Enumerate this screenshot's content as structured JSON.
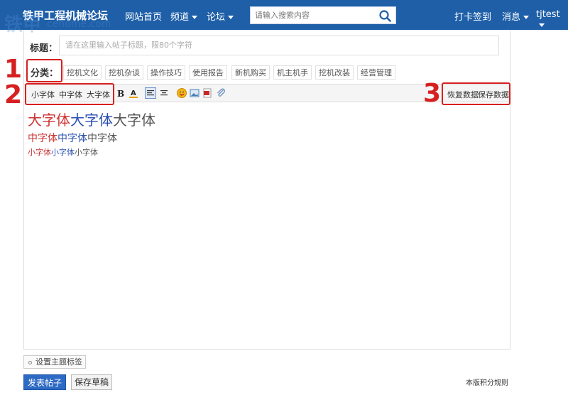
{
  "header": {
    "logo": "铁甲工程机械论坛",
    "watermark": "铁甲",
    "watermark_sub": "cehome.com",
    "nav": [
      {
        "label": "网站首页",
        "has_caret": false
      },
      {
        "label": "频道",
        "has_caret": true
      },
      {
        "label": "论坛",
        "has_caret": true
      }
    ],
    "search_placeholder": "请输入搜索内容",
    "checkin": "打卡签到",
    "messages": "消息",
    "username": "tjtest"
  },
  "form": {
    "title_label": "标题：",
    "title_placeholder": "请在这里输入帖子标题，限80个字符",
    "category_label": "分类：",
    "categories": [
      "挖机文化",
      "挖机杂谈",
      "操作技巧",
      "使用报告",
      "新机购买",
      "机主机手",
      "挖机改装",
      "经营管理"
    ]
  },
  "toolbar": {
    "font_small": "小字体",
    "font_medium": "中字体",
    "font_large": "大字体",
    "restore": "恢复数据",
    "save": "保存数据"
  },
  "editor": {
    "big_red": "大字体",
    "big_blue": "大字体",
    "big_gray": "大字体",
    "mid_red": "中字体",
    "mid_blue": "中字体",
    "mid_gray": "中字体",
    "small_red": "小字体",
    "small_blue": "小字体",
    "small_gray": "小字体"
  },
  "annotations": {
    "one": "1",
    "two": "2",
    "three": "3"
  },
  "footer": {
    "tag_button": "设置主题标签",
    "submit": "发表帖子",
    "draft": "保存草稿",
    "rules": "本版积分规则"
  },
  "colors": {
    "header_bg": "#1e5fa8",
    "annotation": "#d62020",
    "red_text": "#cc3333",
    "blue_text": "#2a4fb0"
  }
}
